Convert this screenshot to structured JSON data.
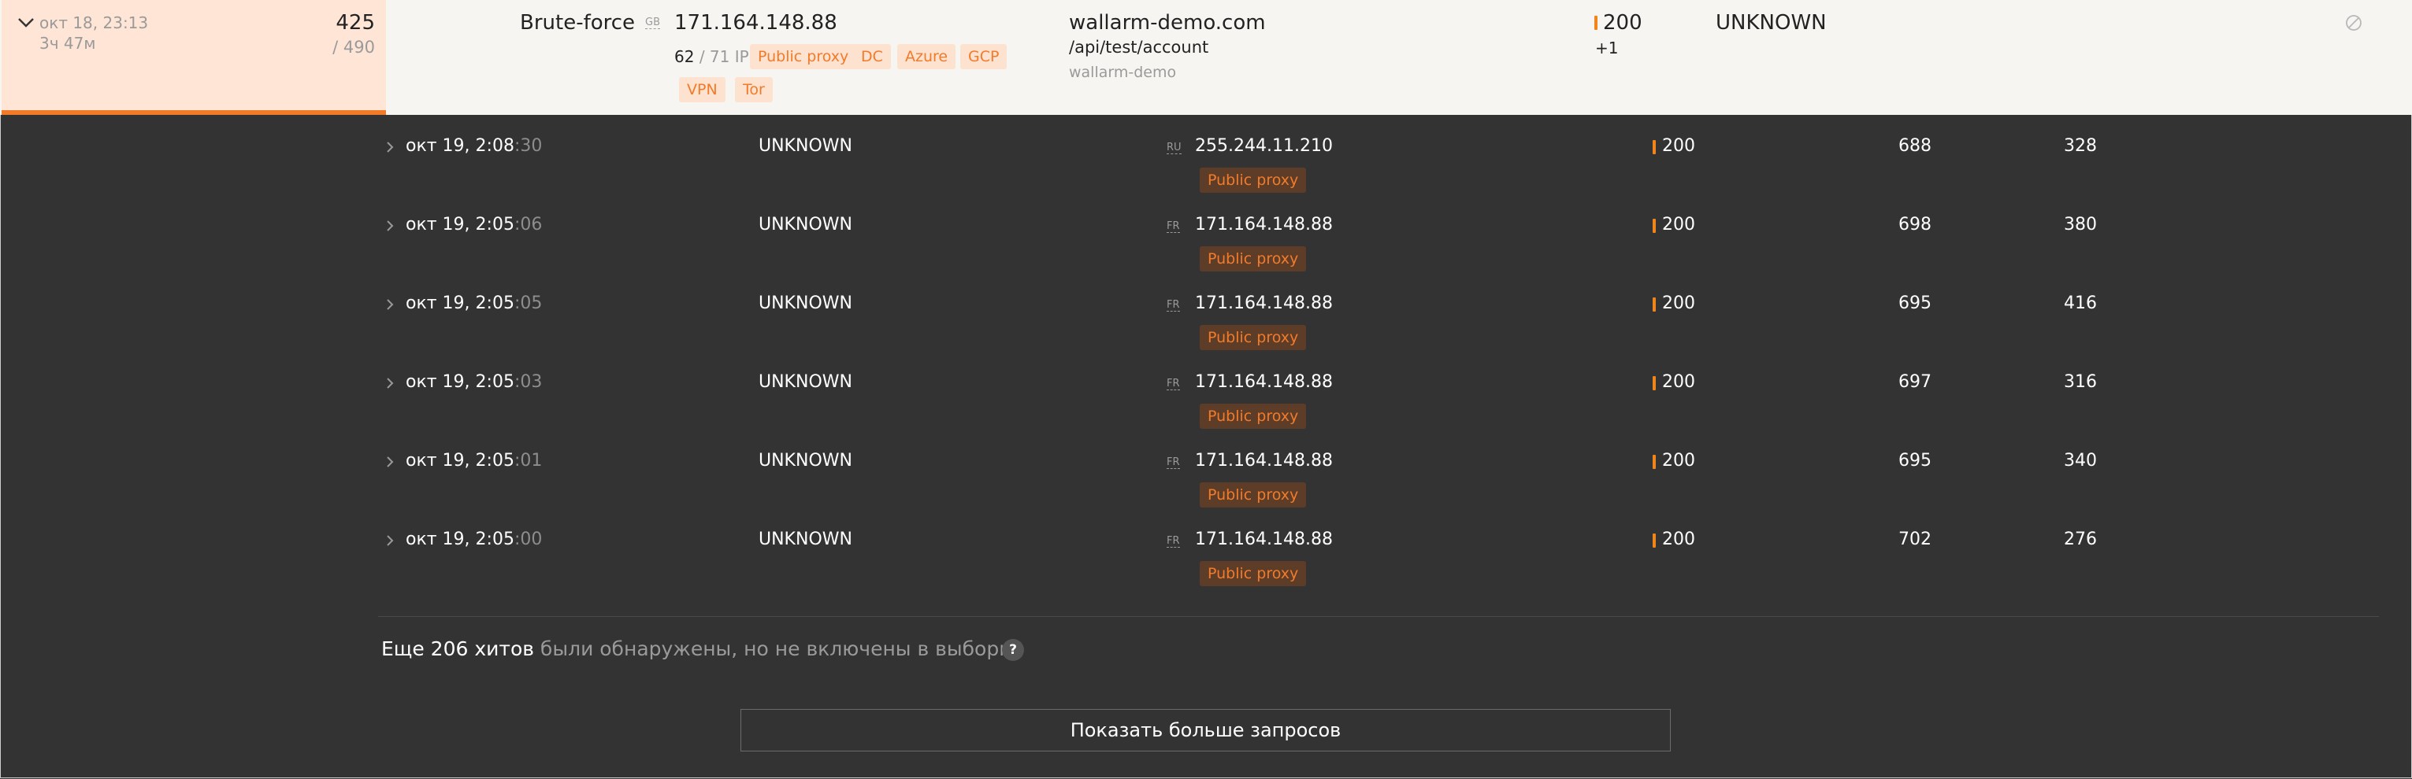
{
  "attack": {
    "date": "окт 18, 23:13",
    "duration": "3ч 47м",
    "hits_count": "425",
    "hits_total": "/ 490",
    "type": "Brute-force",
    "country": "GB",
    "ip": "171.164.148.88",
    "ip_count": "62",
    "ip_total": "/ 71 IP",
    "tags": [
      "Public proxy",
      "DC",
      "Azure",
      "GCP",
      "VPN",
      "Tor"
    ],
    "domain": "wallarm-demo.com",
    "path": "/api/test/account",
    "application": "wallarm-demo",
    "status": "200",
    "status_more": "+1",
    "parameter": "UNKNOWN",
    "colors": {
      "accent": "#f27b2a",
      "header_bg": "#ffe5d6",
      "panel_bg": "#333333"
    }
  },
  "requests": [
    {
      "time": "окт 19, 2:08",
      "sec": ":30",
      "attack": "UNKNOWN",
      "country": "RU",
      "ip": "255.244.11.210",
      "tag": "Public proxy",
      "status": "200",
      "size": "688",
      "resp_time": "328"
    },
    {
      "time": "окт 19, 2:05",
      "sec": ":06",
      "attack": "UNKNOWN",
      "country": "FR",
      "ip": "171.164.148.88",
      "tag": "Public proxy",
      "status": "200",
      "size": "698",
      "resp_time": "380"
    },
    {
      "time": "окт 19, 2:05",
      "sec": ":05",
      "attack": "UNKNOWN",
      "country": "FR",
      "ip": "171.164.148.88",
      "tag": "Public proxy",
      "status": "200",
      "size": "695",
      "resp_time": "416"
    },
    {
      "time": "окт 19, 2:05",
      "sec": ":03",
      "attack": "UNKNOWN",
      "country": "FR",
      "ip": "171.164.148.88",
      "tag": "Public proxy",
      "status": "200",
      "size": "697",
      "resp_time": "316"
    },
    {
      "time": "окт 19, 2:05",
      "sec": ":01",
      "attack": "UNKNOWN",
      "country": "FR",
      "ip": "171.164.148.88",
      "tag": "Public proxy",
      "status": "200",
      "size": "695",
      "resp_time": "340"
    },
    {
      "time": "окт 19, 2:05",
      "sec": ":00",
      "attack": "UNKNOWN",
      "country": "FR",
      "ip": "171.164.148.88",
      "tag": "Public proxy",
      "status": "200",
      "size": "702",
      "resp_time": "276"
    }
  ],
  "footer": {
    "more_strong": "Еще 206 хитов",
    "more_muted": " были обнаружены, но не включены в выборку",
    "help": "?",
    "show_more_label": "Показать больше запросов"
  },
  "icons": {
    "expand": "chevron-down-icon",
    "row_expand": "chevron-right-icon",
    "block": "block-icon"
  }
}
